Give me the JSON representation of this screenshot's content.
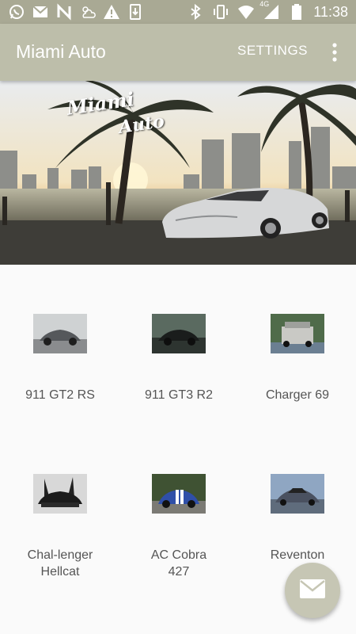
{
  "status_bar": {
    "time": "11:38",
    "network": "4G",
    "left_icons": [
      "whatsapp-icon",
      "gmail-icon",
      "n-app-icon",
      "weather-icon",
      "warning-icon",
      "download-icon"
    ],
    "right_icons": [
      "bluetooth-icon",
      "vibrate-icon",
      "wifi-icon",
      "signal-icon",
      "battery-icon"
    ]
  },
  "app_bar": {
    "title": "Miami Auto",
    "settings_label": "SETTINGS",
    "overflow_icon": "more-vert-icon"
  },
  "hero": {
    "line1": "Miami",
    "line2": "Auto"
  },
  "cars": [
    {
      "label": "911 GT2 RS"
    },
    {
      "label": "911 GT3 R2"
    },
    {
      "label": "Charger 69"
    },
    {
      "label": "Chal-lenger Hellcat"
    },
    {
      "label": "AC Cobra 427"
    },
    {
      "label": "Reventon"
    }
  ],
  "fab": {
    "icon": "mail-icon"
  },
  "colors": {
    "status_bar": "#a9a994",
    "app_bar": "#bdbeaa",
    "fab": "#c6c6b4",
    "label_text": "#555555"
  }
}
